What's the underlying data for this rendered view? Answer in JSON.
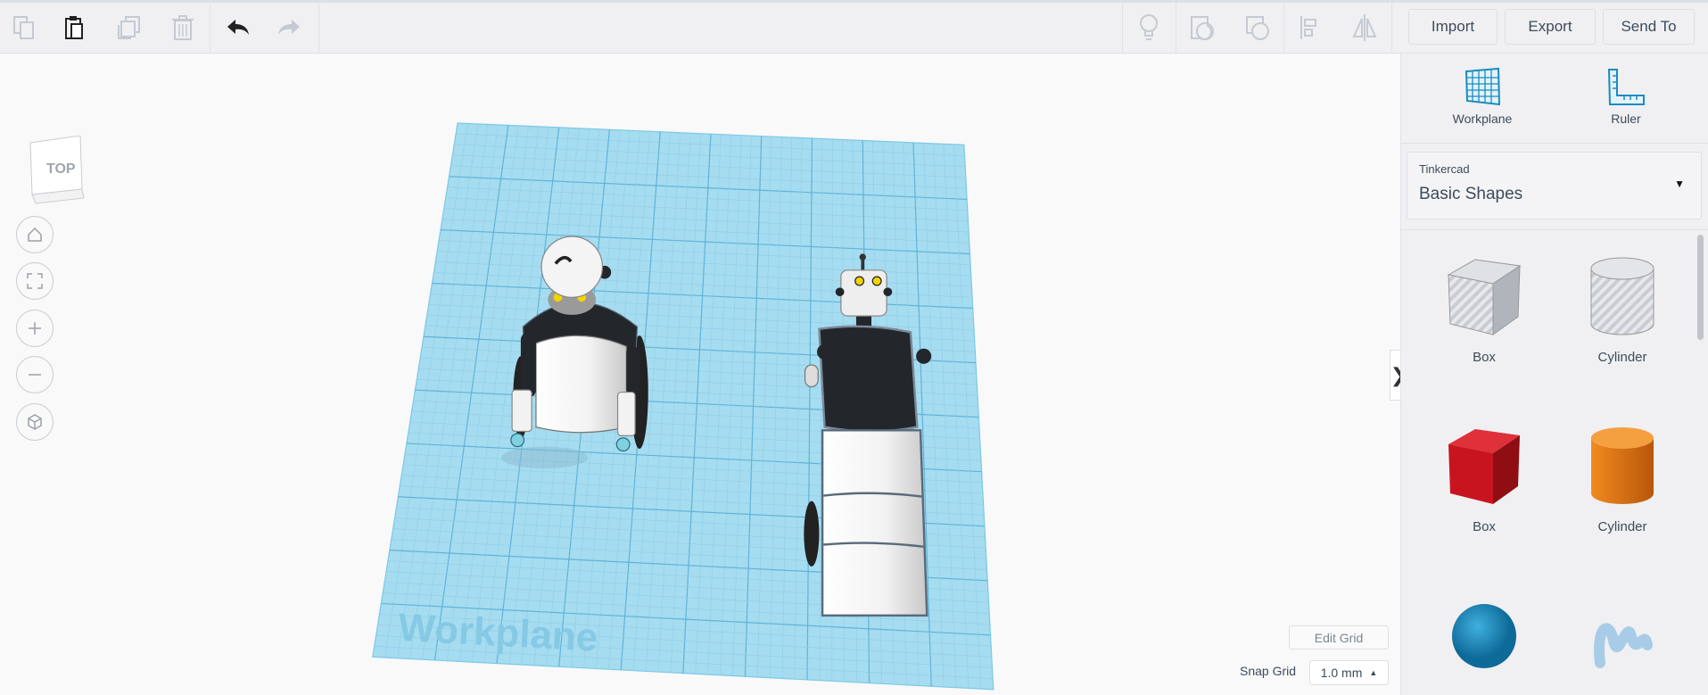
{
  "toolbar": {
    "icons": [
      "copy-icon",
      "paste-icon",
      "duplicate-icon",
      "delete-icon",
      "undo-icon",
      "redo-icon",
      "note-icon",
      "group-icon",
      "ungroup-icon",
      "align-icon",
      "mirror-icon"
    ],
    "import_label": "Import",
    "export_label": "Export",
    "send_to_label": "Send To"
  },
  "viewport": {
    "view_cube_label": "TOP",
    "workplane_watermark": "Workplane",
    "edit_grid_label": "Edit Grid",
    "snap_grid_label": "Snap Grid",
    "snap_grid_value": "1.0 mm",
    "collapse_glyph": "❯"
  },
  "sidebar": {
    "tools": [
      {
        "label": "Workplane"
      },
      {
        "label": "Ruler"
      }
    ],
    "library": {
      "provider": "Tinkercad",
      "selected": "Basic Shapes"
    },
    "shapes": [
      {
        "label": "Box",
        "color": "#b8bcc4"
      },
      {
        "label": "Cylinder",
        "color": "#c4c7cc"
      },
      {
        "label": "Box",
        "color": "#c8141e"
      },
      {
        "label": "Cylinder",
        "color": "#e0700f"
      },
      {
        "label": "",
        "color": "#1a8cc0"
      },
      {
        "label": "",
        "color": "#a8cce8"
      }
    ]
  },
  "colors": {
    "workplane": "#9fd8ef",
    "grid": "#6bbfe0",
    "accent": "#1a8cc0"
  }
}
